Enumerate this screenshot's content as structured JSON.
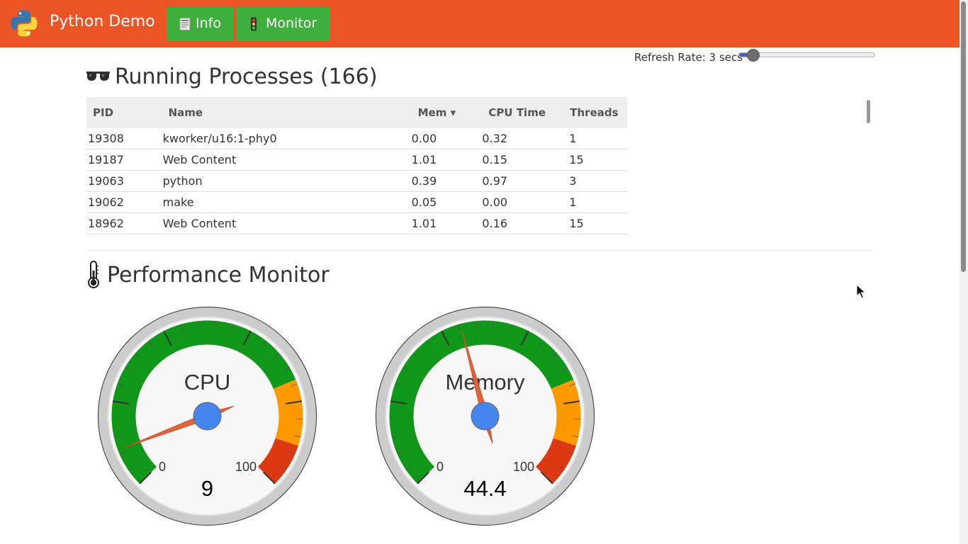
{
  "app": {
    "brand": "Python Demo",
    "nav": [
      {
        "label": "Info",
        "icon": "document-icon"
      },
      {
        "label": "Monitor",
        "icon": "traffic-light-icon"
      }
    ],
    "colors": {
      "navbar": "#eb5424",
      "nav_button": "#3eae3c",
      "gauge_green": "#109618",
      "gauge_orange": "#ff9900",
      "gauge_red": "#dc3912",
      "needle": "#e2643d",
      "hub": "#4684ee"
    }
  },
  "refresh": {
    "label": "Refresh Rate: 3 secs",
    "value_seconds": 3
  },
  "processes": {
    "title": "Running Processes (166)",
    "icon": "sunglasses-icon",
    "columns": [
      "PID",
      "Name",
      "Mem ▾",
      "CPU Time",
      "Threads"
    ],
    "rows": [
      [
        "19308",
        "kworker/u16:1-phy0",
        "0.00",
        "0.32",
        "1"
      ],
      [
        "19187",
        "Web Content",
        "1.01",
        "0.15",
        "15"
      ],
      [
        "19063",
        "python",
        "0.39",
        "0.97",
        "3"
      ],
      [
        "19062",
        "make",
        "0.05",
        "0.00",
        "1"
      ],
      [
        "18962",
        "Web Content",
        "1.01",
        "0.16",
        "15"
      ]
    ]
  },
  "performance": {
    "title": "Performance Monitor",
    "icon": "thermometer-icon",
    "gauges": [
      {
        "label": "CPU",
        "value": 9,
        "display": "9",
        "min_label": "0",
        "max_label": "100"
      },
      {
        "label": "Memory",
        "value": 44.4,
        "display": "44.4",
        "min_label": "0",
        "max_label": "100"
      }
    ]
  }
}
